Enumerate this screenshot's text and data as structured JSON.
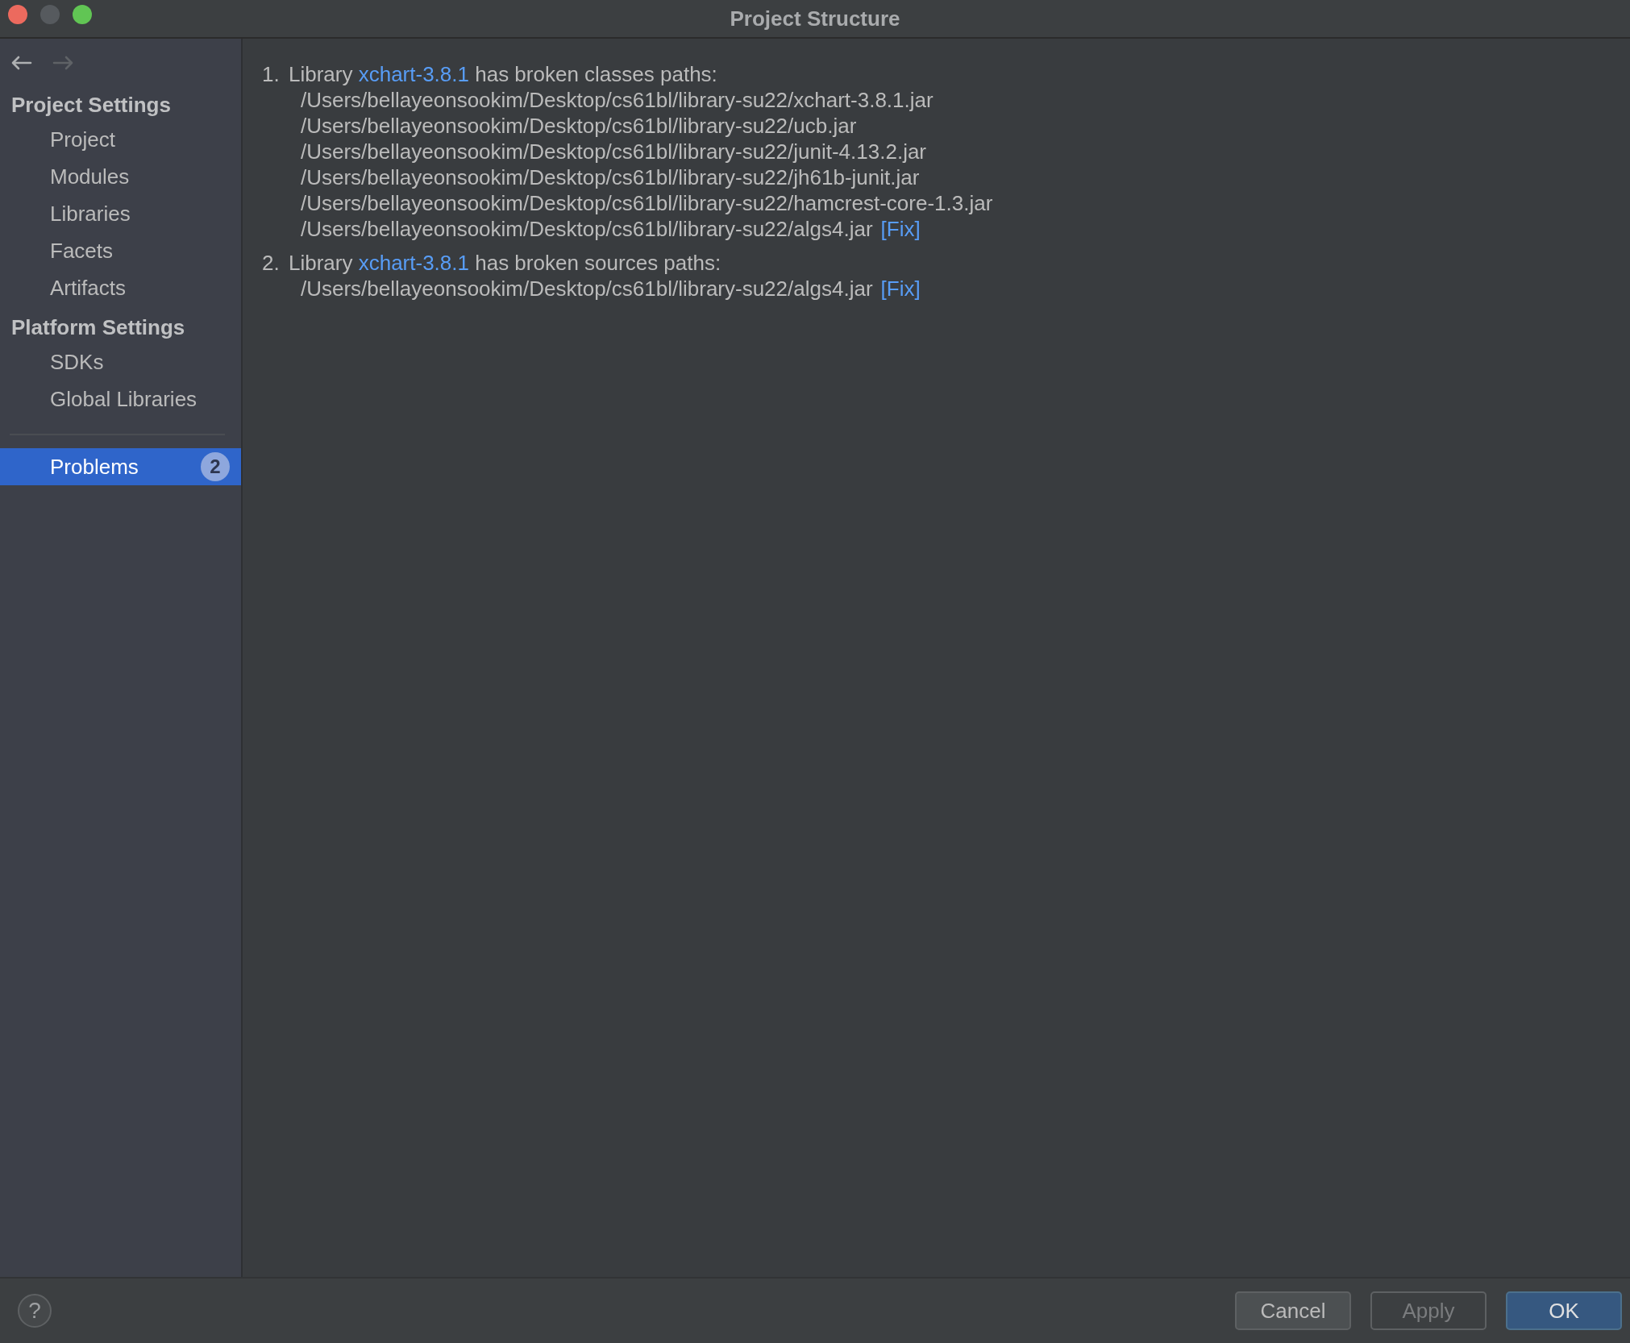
{
  "window": {
    "title": "Project Structure"
  },
  "nav": {
    "back_disabled": false,
    "forward_disabled": true
  },
  "sidebar": {
    "sections": [
      {
        "title": "Project Settings",
        "items": [
          {
            "label": "Project",
            "selected": false
          },
          {
            "label": "Modules",
            "selected": false
          },
          {
            "label": "Libraries",
            "selected": false
          },
          {
            "label": "Facets",
            "selected": false
          },
          {
            "label": "Artifacts",
            "selected": false
          }
        ]
      },
      {
        "title": "Platform Settings",
        "items": [
          {
            "label": "SDKs",
            "selected": false
          },
          {
            "label": "Global Libraries",
            "selected": false
          }
        ]
      }
    ],
    "problems_item": {
      "label": "Problems",
      "badge": "2",
      "selected": true
    }
  },
  "problems": [
    {
      "number": "1.",
      "prefix": "Library",
      "library": "xchart-3.8.1",
      "suffix": "has broken classes paths:",
      "paths": [
        {
          "path": "/Users/bellayeonsookim/Desktop/cs61bl/library-su22/xchart-3.8.1.jar"
        },
        {
          "path": "/Users/bellayeonsookim/Desktop/cs61bl/library-su22/ucb.jar"
        },
        {
          "path": "/Users/bellayeonsookim/Desktop/cs61bl/library-su22/junit-4.13.2.jar"
        },
        {
          "path": "/Users/bellayeonsookim/Desktop/cs61bl/library-su22/jh61b-junit.jar"
        },
        {
          "path": "/Users/bellayeonsookim/Desktop/cs61bl/library-su22/hamcrest-core-1.3.jar"
        },
        {
          "path": "/Users/bellayeonsookim/Desktop/cs61bl/library-su22/algs4.jar",
          "fix": "[Fix]"
        }
      ]
    },
    {
      "number": "2.",
      "prefix": "Library",
      "library": "xchart-3.8.1",
      "suffix": "has broken sources paths:",
      "paths": [
        {
          "path": "/Users/bellayeonsookim/Desktop/cs61bl/library-su22/algs4.jar",
          "fix": "[Fix]"
        }
      ]
    }
  ],
  "help": "?",
  "buttons": [
    {
      "label": "Cancel",
      "disabled": false,
      "default": false
    },
    {
      "label": "Apply",
      "disabled": true,
      "default": false
    },
    {
      "label": "OK",
      "disabled": false,
      "default": true
    }
  ]
}
